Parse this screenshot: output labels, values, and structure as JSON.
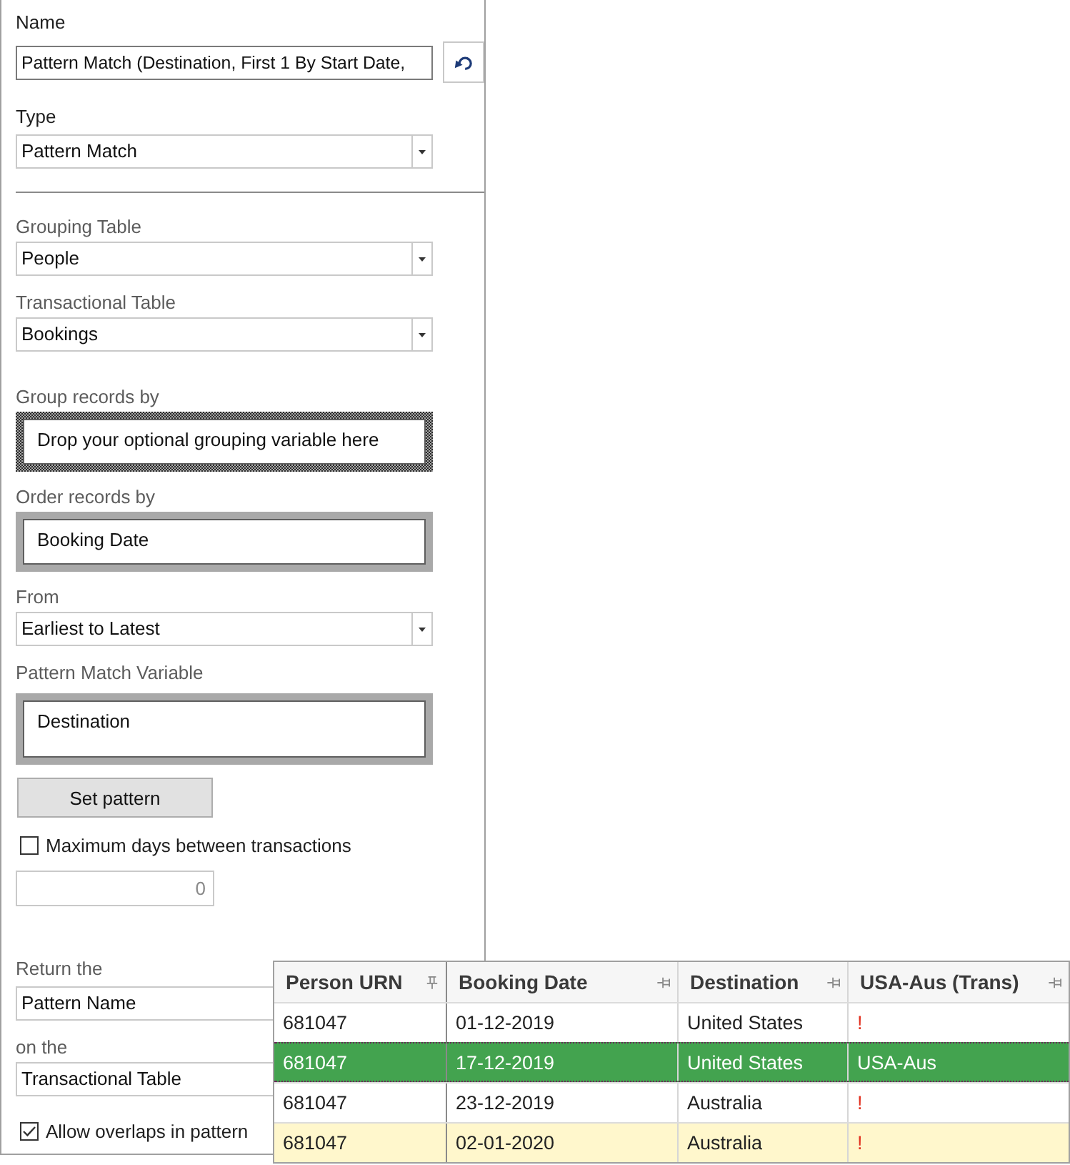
{
  "name": {
    "label": "Name",
    "value": "Pattern Match (Destination, First 1 By Start Date,"
  },
  "type": {
    "label": "Type",
    "value": "Pattern Match"
  },
  "grouping_table": {
    "label": "Grouping Table",
    "value": "People"
  },
  "transactional_table": {
    "label": "Transactional Table",
    "value": "Bookings"
  },
  "group_records_by": {
    "label": "Group records by",
    "placeholder": "Drop your optional grouping variable here"
  },
  "order_records_by": {
    "label": "Order records by",
    "value": "Booking Date"
  },
  "from": {
    "label": "From",
    "value": "Earliest to Latest"
  },
  "pattern_match_variable": {
    "label": "Pattern Match Variable",
    "value": "Destination"
  },
  "set_pattern_button": "Set pattern",
  "max_days": {
    "label": "Maximum days between transactions",
    "checked": false,
    "value": "0",
    "disabled": true
  },
  "return_the": {
    "label": "Return the",
    "value": "Pattern Name"
  },
  "on_the": {
    "label": "on the",
    "value": "Transactional Table"
  },
  "allow_overlaps": {
    "label": "Allow overlaps in pattern",
    "checked": true
  },
  "results_table": {
    "columns": [
      {
        "label": "Person URN",
        "pinned": true
      },
      {
        "label": "Booking Date",
        "pinned": false
      },
      {
        "label": "Destination",
        "pinned": false
      },
      {
        "label": "USA-Aus (Trans)",
        "pinned": false
      }
    ],
    "rows": [
      {
        "cells": [
          "681047",
          "01-12-2019",
          "United States",
          "!"
        ],
        "selected": false,
        "highlighted": false,
        "matched": false
      },
      {
        "cells": [
          "681047",
          "17-12-2019",
          "United States",
          "USA-Aus"
        ],
        "selected": true,
        "highlighted": false,
        "matched": true
      },
      {
        "cells": [
          "681047",
          "23-12-2019",
          "Australia",
          "!"
        ],
        "selected": false,
        "highlighted": false,
        "matched": false
      },
      {
        "cells": [
          "681047",
          "02-01-2020",
          "Australia",
          "!"
        ],
        "selected": false,
        "highlighted": true,
        "matched": false
      }
    ]
  }
}
